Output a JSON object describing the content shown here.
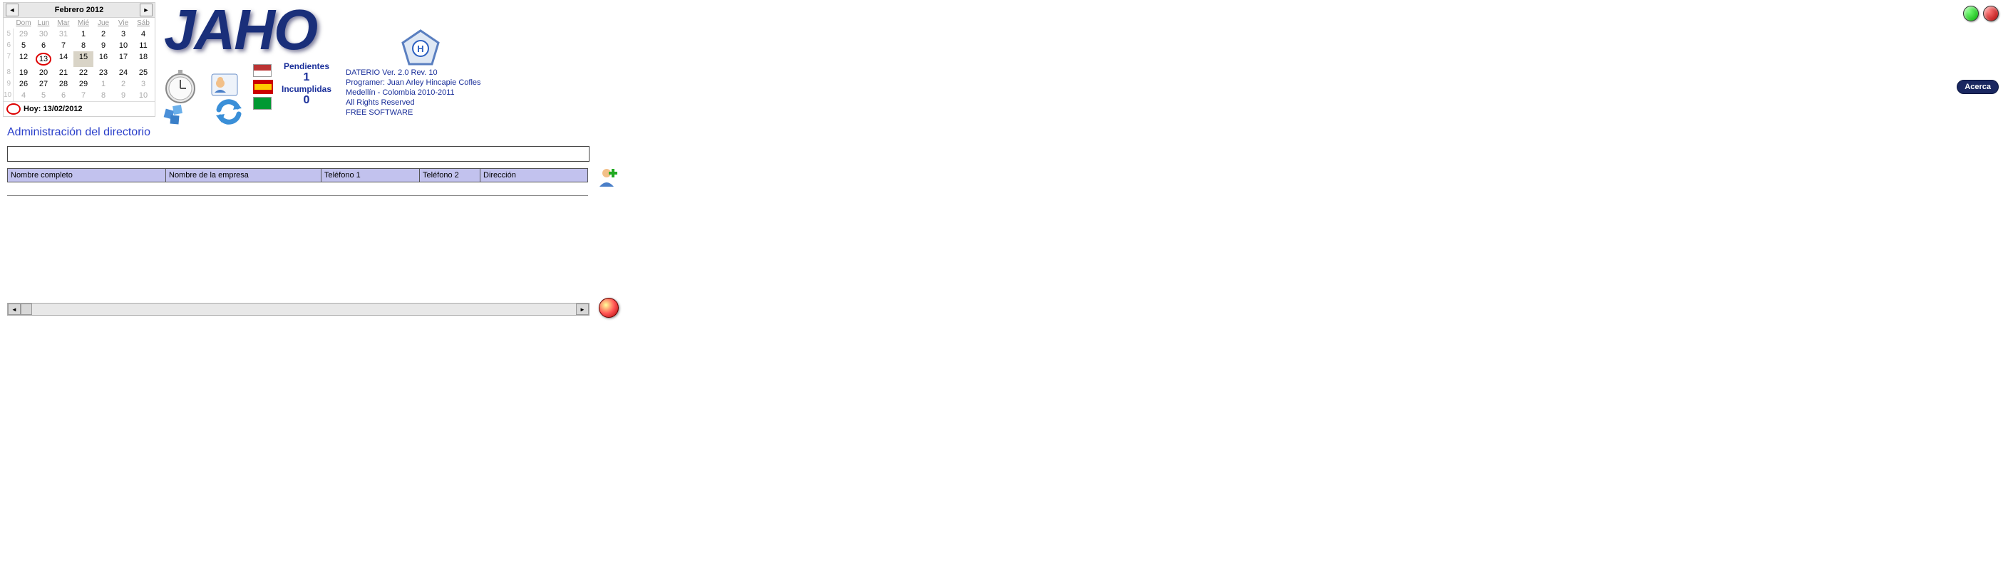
{
  "calendar": {
    "title": "Febrero 2012",
    "dow": [
      "Dom",
      "Lun",
      "Mar",
      "Mié",
      "Jue",
      "Vie",
      "Sáb"
    ],
    "weeks": [
      "5",
      "6",
      "7",
      "8",
      "9",
      "10"
    ],
    "grid": [
      [
        "29",
        "30",
        "31",
        "1",
        "2",
        "3",
        "4"
      ],
      [
        "5",
        "6",
        "7",
        "8",
        "9",
        "10",
        "11"
      ],
      [
        "12",
        "13",
        "14",
        "15",
        "16",
        "17",
        "18"
      ],
      [
        "19",
        "20",
        "21",
        "22",
        "23",
        "24",
        "25"
      ],
      [
        "26",
        "27",
        "28",
        "29",
        "1",
        "2",
        "3"
      ],
      [
        "4",
        "5",
        "6",
        "7",
        "8",
        "9",
        "10"
      ]
    ],
    "today_label": "Hoy: 13/02/2012"
  },
  "logo_text": "JAHO",
  "counters": {
    "pend_label": "Pendientes",
    "pend_value": "1",
    "incu_label": "Incumplidas",
    "incu_value": "0"
  },
  "info": {
    "l1": "DATERIO Ver. 2.0 Rev. 10",
    "l2": "Programer: Juan Arley Hincapie Cofles",
    "l3": "Medellín - Colombia 2010-2011",
    "l4": "All Rights Reserved",
    "l5": "FREE SOFTWARE"
  },
  "acerca_label": "Acerca",
  "section_title": "Administración del directorio",
  "search": {
    "value": ""
  },
  "table": {
    "headers": {
      "c1": "Nombre completo",
      "c2": "Nombre de la empresa",
      "c3": "Teléfono 1",
      "c4": "Teléfono 2",
      "c5": "Dirección"
    },
    "rows": []
  }
}
